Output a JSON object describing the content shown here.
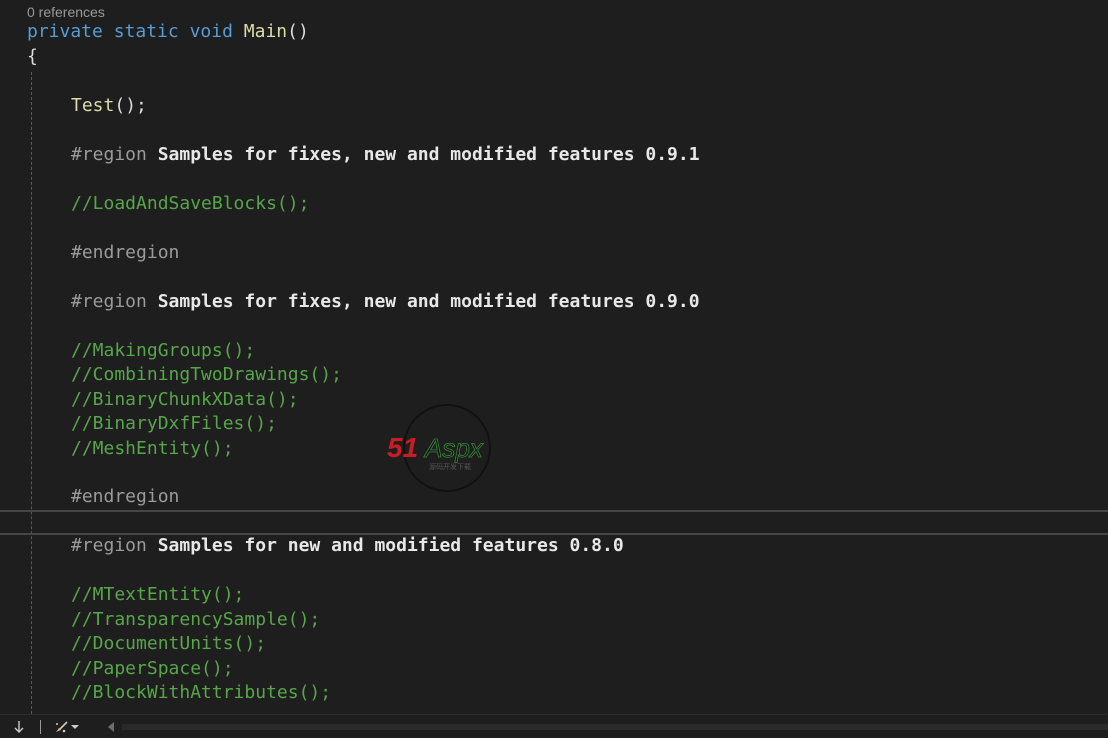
{
  "editor": {
    "codelens": "0 references",
    "colors": {
      "background": "#1e1e1e",
      "keyword": "#569cd6",
      "method": "#dcdcaa",
      "comment": "#57a64a",
      "directive": "#9b9b9b",
      "text": "#dcdcdc"
    },
    "signature": {
      "kw_private": "private",
      "kw_static": "static",
      "kw_void": "void",
      "method": "Main",
      "parens": "()"
    },
    "open_brace": "{",
    "call_test": {
      "name": "Test",
      "suffix": "();"
    },
    "region_directive": "#region",
    "endregion_directive": "#endregion",
    "regions": [
      {
        "title": "Samples for fixes, new and modified features 0.9.1",
        "lines": [
          "//LoadAndSaveBlocks();"
        ]
      },
      {
        "title": "Samples for fixes, new and modified features 0.9.0",
        "lines": [
          "//MakingGroups();",
          "//CombiningTwoDrawings();",
          "//BinaryChunkXData();",
          "//BinaryDxfFiles();",
          "//MeshEntity();"
        ]
      },
      {
        "title": "Samples for new and modified features 0.8.0",
        "lines": [
          "//MTextEntity();",
          "//TransparencySample();",
          "//DocumentUnits();",
          "//PaperSpace();",
          "//BlockWithAttributes();"
        ]
      }
    ]
  },
  "watermark": {
    "red_text": "51",
    "green_text": "Aspx",
    "sub_text": "源码开发下载"
  },
  "statusbar": {
    "icons": [
      "arrow-down-icon",
      "brush-icon",
      "chevron-down-icon",
      "scroll-left-icon"
    ]
  }
}
